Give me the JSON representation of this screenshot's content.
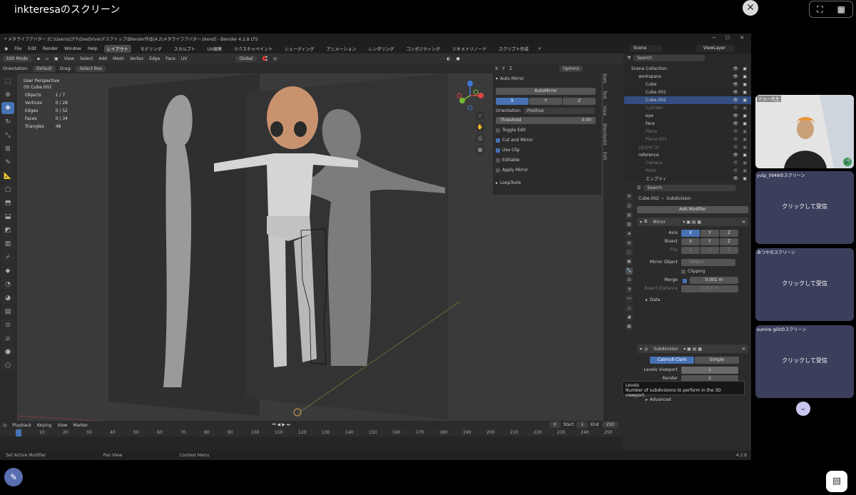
{
  "share": {
    "title": "inkteresaのスクリーン"
  },
  "blender": {
    "window_title": "* メタライフアバター [C:\\Users\\CITY\\OneDrive\\デスクトップ\\Blender作品\\4.2\\メタライフアバター.blend] - Blender 4.2.8 LTS",
    "menus": [
      "File",
      "Edit",
      "Render",
      "Window",
      "Help"
    ],
    "workspaces": [
      "レイアウト",
      "モデリング",
      "スカルプト",
      "UV編集",
      "テクスチャペイント",
      "シェーディング",
      "アニメーション",
      "レンダリング",
      "コンポジティング",
      "ジオメトリノード",
      "スクリプト作成"
    ],
    "active_workspace": "レイアウト",
    "scene": "Scene",
    "view_layer": "ViewLayer",
    "mode": "Edit Mode",
    "vp_menus": [
      "View",
      "Select",
      "Add",
      "Mesh",
      "Vertex",
      "Edge",
      "Face",
      "UV"
    ],
    "transform_orientation": "Global",
    "orientation_label": "Orientation:",
    "orientation_value": "Default",
    "drag_label": "Drag:",
    "drag_value": "Select Box",
    "axes": [
      "X",
      "Y",
      "Z"
    ],
    "options": "Options",
    "viewport_info": {
      "title": "User Perspective",
      "object": "(0) Cube.002",
      "stats": [
        {
          "label": "Objects",
          "value": "1 / 7"
        },
        {
          "label": "Vertices",
          "value": "0 / 28"
        },
        {
          "label": "Edges",
          "value": "0 / 52"
        },
        {
          "label": "Faces",
          "value": "0 / 34"
        },
        {
          "label": "Triangles",
          "value": "48"
        }
      ]
    },
    "auto_mirror": {
      "header": "Auto Mirror",
      "button": "AutoMirror",
      "axes": [
        "X",
        "Y",
        "Z"
      ],
      "orientation_label": "Orientation:",
      "orientation_value": "Positive",
      "threshold_label": "Threshold",
      "threshold_value": "0.00",
      "toggle_edit": "Toggle Edit",
      "cut_and_mirror": "Cut and Mirror",
      "use_clip": "Use Clip",
      "editable": "Editable",
      "apply_mirror": "Apply Mirror",
      "looptools": "LoopTools"
    },
    "side_tabs": [
      "Item",
      "Tool",
      "View",
      "Blenderkit",
      "Edit"
    ],
    "timeline": {
      "menus": [
        "Playback",
        "Keying",
        "View",
        "Marker"
      ],
      "current": "0",
      "start_label": "Start",
      "start": "1",
      "end_label": "End",
      "end": "250",
      "ticks": [
        "0",
        "10",
        "20",
        "30",
        "40",
        "50",
        "60",
        "70",
        "80",
        "90",
        "100",
        "110",
        "120",
        "130",
        "140",
        "150",
        "160",
        "170",
        "180",
        "190",
        "200",
        "210",
        "220",
        "230",
        "240",
        "250"
      ]
    },
    "status": [
      "Set Active Modifier",
      "Pan View",
      "Context Menu"
    ],
    "version": "4.2.8",
    "outliner": {
      "search_placeholder": "Search",
      "rows": [
        {
          "label": "Scene Collection",
          "indent": 0,
          "dim": false,
          "sel": false
        },
        {
          "label": "workspace",
          "indent": 1,
          "dim": false,
          "sel": false
        },
        {
          "label": "Cube",
          "indent": 2,
          "dim": false,
          "sel": false
        },
        {
          "label": "Cube.001",
          "indent": 2,
          "dim": false,
          "sel": false
        },
        {
          "label": "Cube.002",
          "indent": 2,
          "dim": false,
          "sel": true
        },
        {
          "label": "Cylinder",
          "indent": 2,
          "dim": true,
          "sel": false
        },
        {
          "label": "eye",
          "indent": 2,
          "dim": false,
          "sel": false
        },
        {
          "label": "face",
          "indent": 2,
          "dim": false,
          "sel": false
        },
        {
          "label": "Plane",
          "indent": 2,
          "dim": true,
          "sel": false
        },
        {
          "label": "Plane.001",
          "indent": 2,
          "dim": true,
          "sel": false
        },
        {
          "label": "(元のやつ)",
          "indent": 1,
          "dim": true,
          "sel": false
        },
        {
          "label": "reference",
          "indent": 1,
          "dim": false,
          "sel": false
        },
        {
          "label": "Camera",
          "indent": 2,
          "dim": true,
          "sel": false
        },
        {
          "label": "Point",
          "indent": 2,
          "dim": true,
          "sel": false
        },
        {
          "label": "エンプティ",
          "indent": 2,
          "dim": false,
          "sel": false
        }
      ]
    },
    "properties": {
      "search_placeholder": "Search",
      "object": "Cube.002",
      "context": "Subdivision",
      "add_modifier": "Add Modifier",
      "mirror": {
        "name": "Mirror",
        "axis_label": "Axis",
        "bisect_label": "Bisect",
        "flip_label": "Flip",
        "axes": [
          "X",
          "Y",
          "Z"
        ],
        "mirror_object_label": "Mirror Object",
        "mirror_object_placeholder": "Object",
        "clipping": "Clipping",
        "merge_label": "Merge",
        "merge_value": "0.001 m",
        "bisect_distance_label": "Bisect Distance",
        "bisect_distance_value": "0.001 m",
        "data": "Data"
      },
      "subdivision": {
        "name": "Subdivision",
        "catmull": "Catmull-Clark",
        "simple": "Simple",
        "levels_label": "Levels Viewport",
        "levels_value": "1",
        "render_label": "Render",
        "render_value": "2",
        "advanced": "Advanced"
      },
      "tooltip_title": "Levels",
      "tooltip_text": "Number of subdivisions to perform in the 3D viewport."
    }
  },
  "participants": {
    "camera_name": "ドゥー先生",
    "tiles": [
      {
        "name": "yutp_0948のスクリーン",
        "action": "クリックして受信"
      },
      {
        "name": "あつやのスクリーン",
        "action": "クリックして受信"
      },
      {
        "name": "sumire gilitのスクリーン",
        "action": "クリックして受信"
      }
    ]
  },
  "colors": {
    "accent": "#4772b3",
    "selected": "#334d80",
    "tile": "#3c3f5c"
  }
}
